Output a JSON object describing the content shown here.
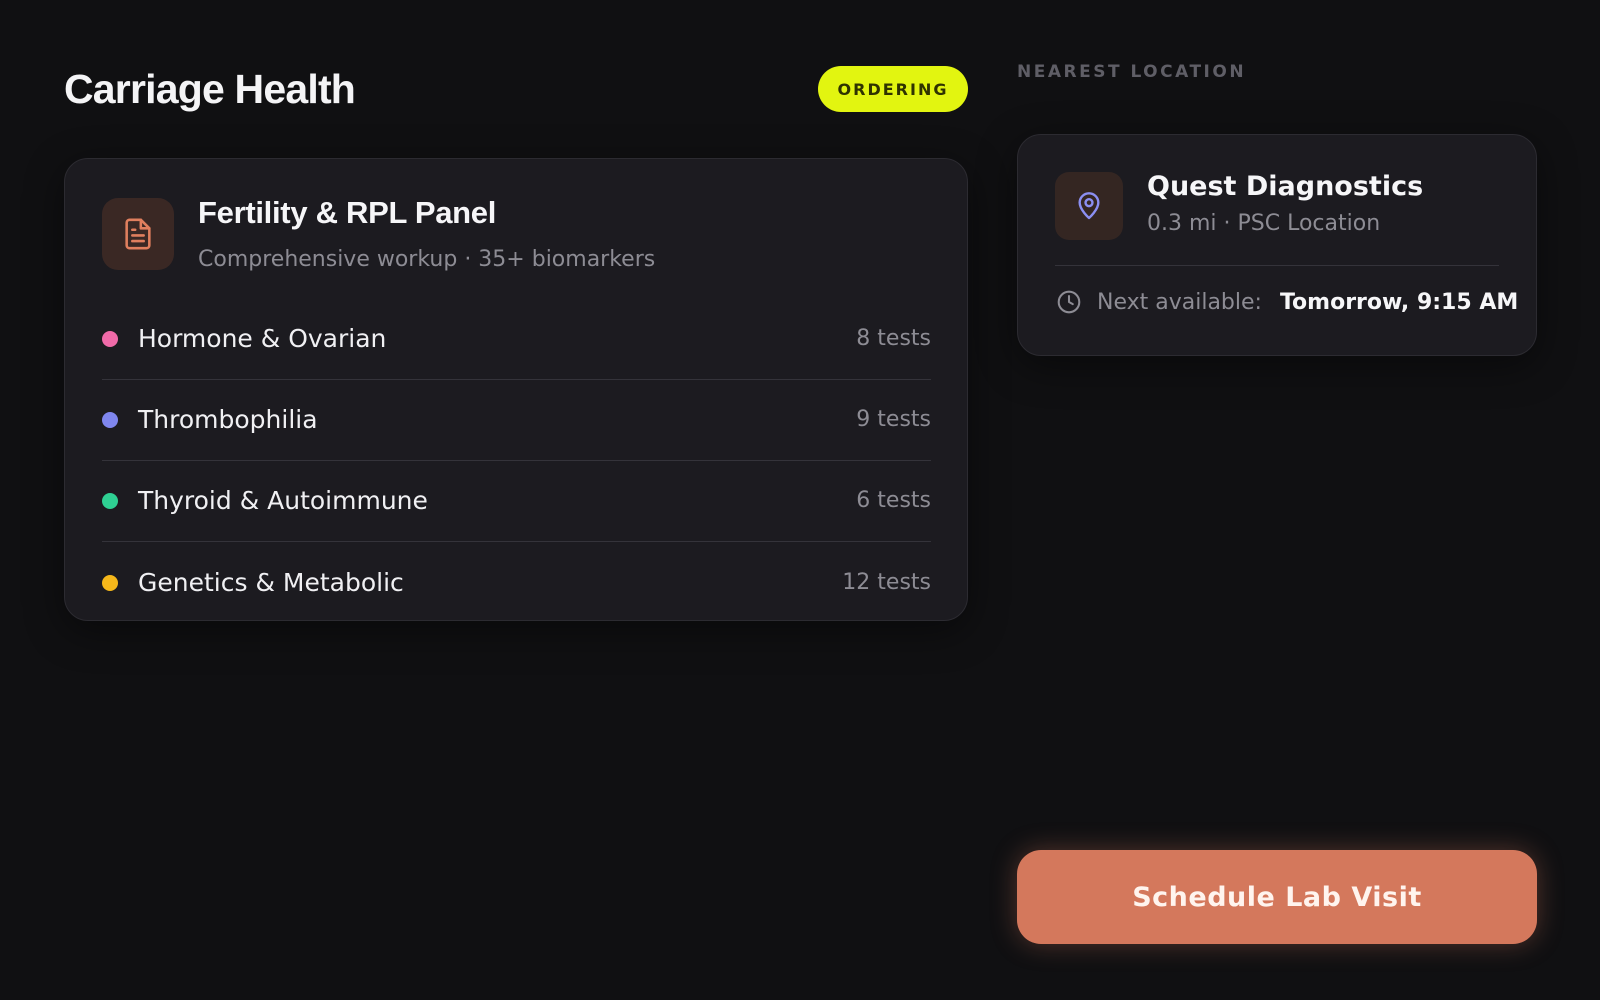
{
  "header": {
    "app_title": "Carriage Health",
    "status_badge": "ORDERING"
  },
  "panel": {
    "icon": "document-icon",
    "title": "Fertility & RPL Panel",
    "subtitle": "Comprehensive workup · 35+ biomarkers",
    "categories": [
      {
        "name": "Hormone & Ovarian",
        "count": "8 tests",
        "color": "#f06aa8"
      },
      {
        "name": "Thrombophilia",
        "count": "9 tests",
        "color": "#7f86ee"
      },
      {
        "name": "Thyroid & Autoimmune",
        "count": "6 tests",
        "color": "#2fd093"
      },
      {
        "name": "Genetics & Metabolic",
        "count": "12 tests",
        "color": "#f5b71a"
      }
    ]
  },
  "location": {
    "section_label": "NEAREST LOCATION",
    "icon": "map-pin-icon",
    "name": "Quest Diagnostics",
    "meta": "0.3 mi · PSC Location",
    "availability_icon": "clock-icon",
    "availability_label": "Next available:",
    "availability_value": "Tomorrow, 9:15 AM"
  },
  "actions": {
    "schedule_label": "Schedule Lab Visit"
  },
  "colors": {
    "accent": "#d4785c",
    "badge": "#e2f510",
    "background": "#101012",
    "card": "#1c1b20"
  }
}
